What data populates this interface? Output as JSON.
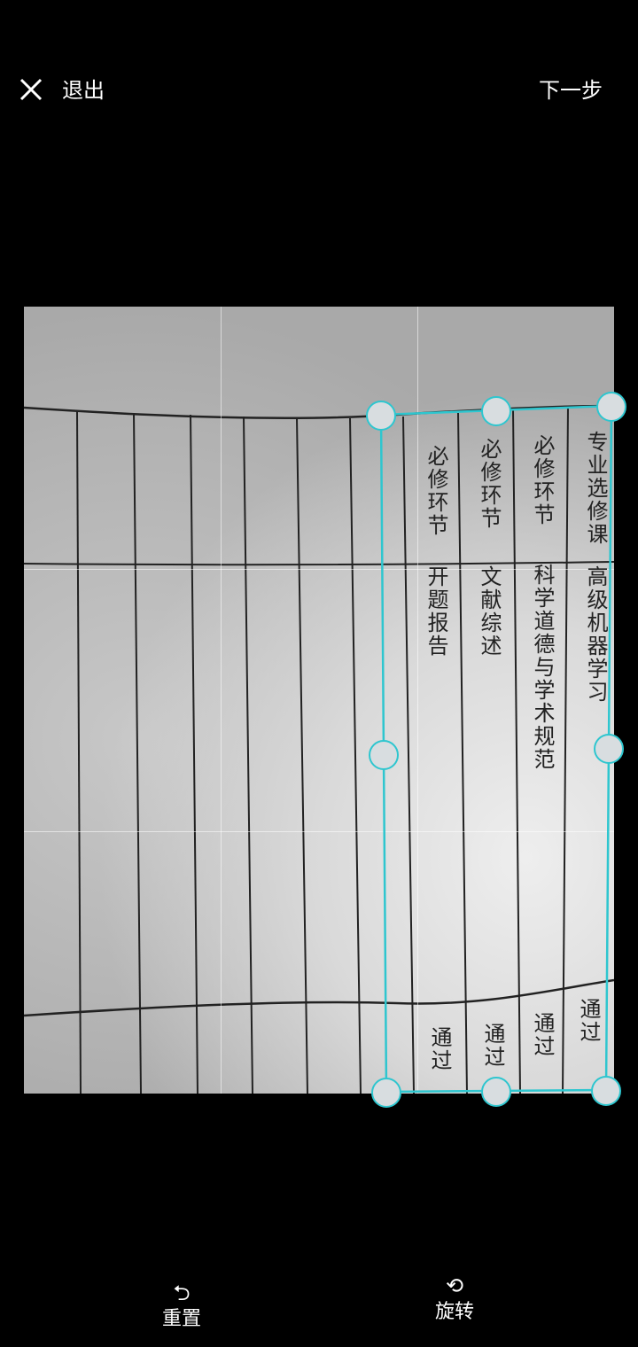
{
  "header": {
    "exit_label": "退出",
    "next_label": "下一步"
  },
  "document": {
    "rows": [
      {
        "type": "专业选修课",
        "course": "高级机器学习",
        "result": "通过"
      },
      {
        "type": "必修环节",
        "course": "科学道德与学术规范",
        "result": "通过"
      },
      {
        "type": "必修环节",
        "course": "文献综述",
        "result": "通过"
      },
      {
        "type": "必修环节",
        "course": "开题报告",
        "result": "通过"
      }
    ]
  },
  "toolbar": {
    "reset_label": "重置",
    "reset_icon": "undo-arrow-icon",
    "rotate_label": "旋转",
    "rotate_icon": "rotate-icon"
  },
  "colors": {
    "background": "#000000",
    "crop_accent": "#2ec6cf",
    "text": "#ffffff"
  }
}
